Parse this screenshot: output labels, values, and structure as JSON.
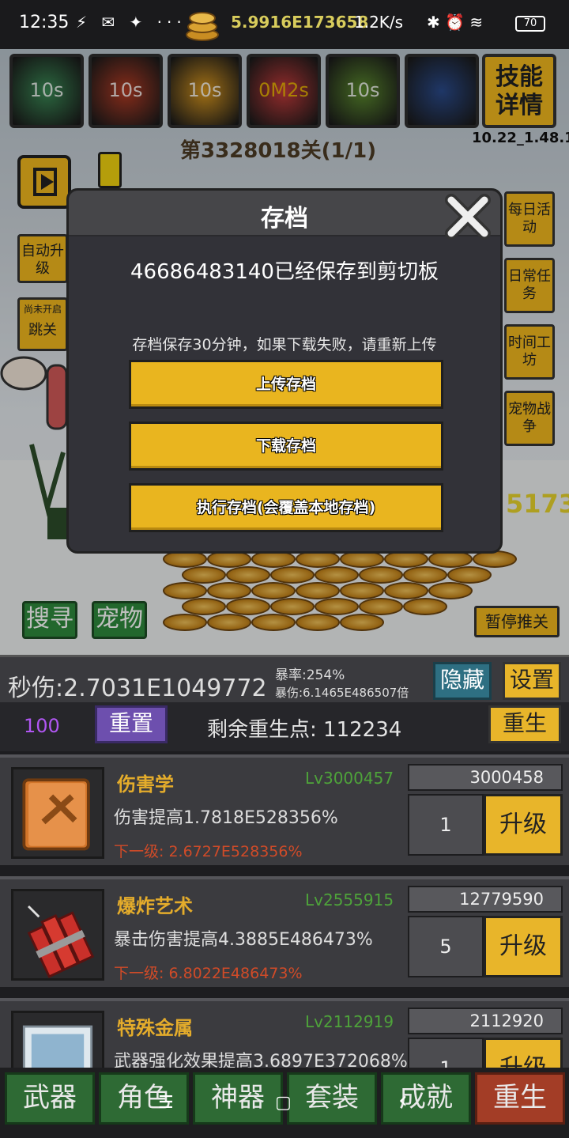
{
  "status_bar": {
    "time": "12:35",
    "left_icons": "⚡ ✉ ✦ ···",
    "gold": "5.9916E173658",
    "net_speed": "1.2K/s",
    "right_icons": "✱ ⏰ ≋",
    "battery": "70"
  },
  "skills": [
    {
      "timer": "10s",
      "color": "#3a8a55"
    },
    {
      "timer": "10s",
      "color": "#b33b24"
    },
    {
      "timer": "10s",
      "color": "#d7961e"
    },
    {
      "timer": "0M2s",
      "color": "#c23a3a"
    },
    {
      "timer": "10s",
      "color": "#5b8a2e"
    },
    {
      "timer": "",
      "color": "#2a4a8a"
    }
  ],
  "skill_detail_label": "技能详情",
  "version": "10.22_1.48.1",
  "stage_label": "第3328018关(1/1)",
  "side_left": {
    "auto_upgrade": "自动升级",
    "skip_note": "尚未开启",
    "skip": "跳关"
  },
  "side_right": {
    "daily_event": "每日活动",
    "daily_task": "日常任务",
    "time_workshop": "时间工坊",
    "pet_battle": "宠物战争"
  },
  "enemy_damage_text": "5173",
  "scene_buttons": {
    "search": "搜寻",
    "pet": "宠物",
    "pause": "暂停推关"
  },
  "modal": {
    "title": "存档",
    "message": "46686483140已经保存到剪切板",
    "hint": "存档保存30分钟，如果下载失败，请重新上传",
    "upload": "上传存档",
    "download": "下载存档",
    "execute": "执行存档(会覆盖本地存档)"
  },
  "stats": {
    "dps": "秒伤:2.7031E1049772",
    "crit_rate": "暴率:254%",
    "crit_damage": "暴伤:6.1465E486507倍",
    "hide": "隐藏",
    "settings": "设置"
  },
  "rebirth": {
    "level": "100",
    "reset": "重置",
    "remaining": "剩余重生点: 112234",
    "rebirth": "重生"
  },
  "upgrades": [
    {
      "name": "伤害学",
      "level": "Lv3000457",
      "desc": "伤害提高1.7818E528356%",
      "next": "下一级: 2.6727E528356%",
      "cost": "3000458",
      "qty": "1",
      "button": "升级"
    },
    {
      "name": "爆炸艺术",
      "level": "Lv2555915",
      "desc": "暴击伤害提高4.3885E486473%",
      "next": "下一级: 6.8022E486473%",
      "cost": "12779590",
      "qty": "5",
      "button": "升级"
    },
    {
      "name": "特殊金属",
      "level": "Lv2112919",
      "desc": "武器强化效果提高3.6897E372068%",
      "next": "",
      "cost": "2112920",
      "qty": "1",
      "button": "升级"
    }
  ],
  "tabs": [
    "武器",
    "角色",
    "神器",
    "套装",
    "成就",
    "重生"
  ],
  "nav": {
    "menu": "☰",
    "home": "▢",
    "back": "‹"
  }
}
